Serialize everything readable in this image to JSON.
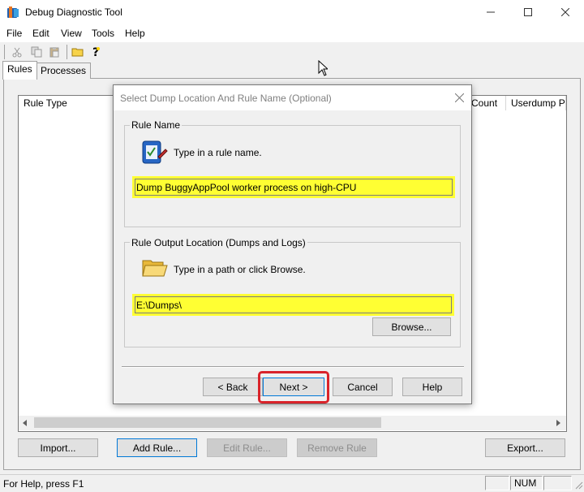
{
  "window": {
    "title": "Debug Diagnostic Tool"
  },
  "menu": [
    "File",
    "Edit",
    "View",
    "Tools",
    "Help"
  ],
  "tabs": [
    "Rules",
    "Processes"
  ],
  "list": {
    "columns": [
      "Rule Type",
      "Count",
      "Userdump Pat"
    ]
  },
  "buttons": {
    "import": "Import...",
    "add_rule": "Add Rule...",
    "edit_rule": "Edit Rule...",
    "remove_rule": "Remove Rule",
    "export": "Export..."
  },
  "status": {
    "text": "For Help, press F1",
    "num": "NUM"
  },
  "dialog": {
    "title": "Select Dump Location And Rule Name (Optional)",
    "rule_name": {
      "group_label": "Rule Name",
      "instruction": "Type in a rule name.",
      "value": "Dump BuggyAppPool worker process on high-CPU"
    },
    "output": {
      "group_label": "Rule Output Location (Dumps and Logs)",
      "instruction": "Type in a path or click Browse.",
      "value": "E:\\Dumps\\",
      "browse_label": "Browse..."
    },
    "back_label": "< Back",
    "next_label": "Next >",
    "cancel_label": "Cancel",
    "help_label": "Help"
  },
  "colors": {
    "highlight_input": "#ffff33",
    "callout_red": "#d9232a",
    "default_button_border": "#0078d7"
  }
}
